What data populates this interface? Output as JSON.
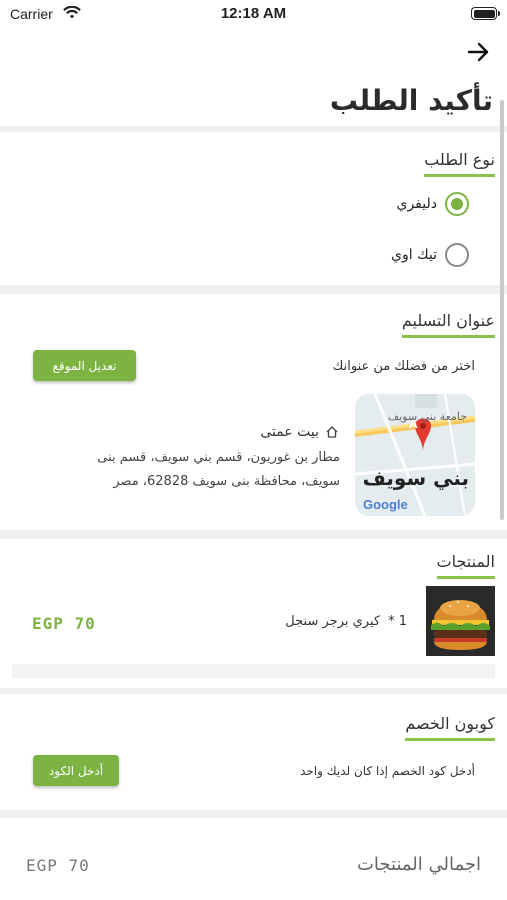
{
  "status_bar": {
    "carrier": "Carrier",
    "time": "12:18 AM"
  },
  "page_title": "تأكيد الطلب",
  "order_type": {
    "title": "نوع الطلب",
    "options": [
      {
        "label": "دليفري",
        "selected": true
      },
      {
        "label": "تيك اوي",
        "selected": false
      }
    ]
  },
  "delivery_address": {
    "title": "عنوان التسليم",
    "prompt": "اختر من فضلك من عنوانك",
    "edit_button": "تعديل الموقع",
    "address_name": "بيت عمتى",
    "address_line1": "مطار بن غوريون، قسم بني سويف، قسم بنى",
    "address_line2": "سويف، محافظة بنى سويف 62828، مصر",
    "map": {
      "city_label": "بني سويف",
      "street_label": "جامعة بني سويف",
      "provider": "Google",
      "marker": "A"
    }
  },
  "products": {
    "title": "المنتجات",
    "items": [
      {
        "quantity": "1 *",
        "name": "كيري برجر سنجل",
        "price": "EGP 70"
      }
    ]
  },
  "coupon": {
    "title": "كوبون الخصم",
    "prompt": "أدخل كود الخصم إذا كان لديك واحد",
    "button": "أدخل الكود"
  },
  "summary": {
    "label": "اجمالي المنتجات",
    "value": "EGP 70"
  },
  "colors": {
    "accent": "#7cb342",
    "divider": "#f0f0f0"
  }
}
